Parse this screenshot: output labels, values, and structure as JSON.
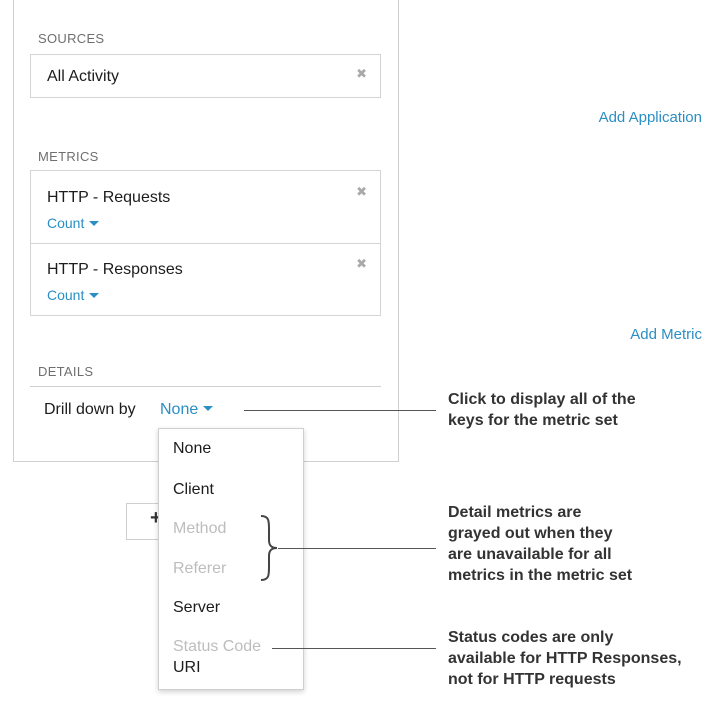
{
  "sources": {
    "label": "SOURCES",
    "items": [
      {
        "title": "All Activity",
        "close_icon": "close-icon"
      }
    ],
    "add_label": "Add Application"
  },
  "metrics": {
    "label": "METRICS",
    "items": [
      {
        "title": "HTTP - Requests",
        "aggregation": "Count"
      },
      {
        "title": "HTTP - Responses",
        "aggregation": "Count"
      }
    ],
    "add_label": "Add Metric"
  },
  "details": {
    "label": "DETAILS",
    "drill_label": "Drill down by",
    "drill_value": "None"
  },
  "dropdown": {
    "options": [
      {
        "label": "None",
        "enabled": true
      },
      {
        "label": "Client",
        "enabled": true
      },
      {
        "label": "Method",
        "enabled": false
      },
      {
        "label": "Referer",
        "enabled": false
      },
      {
        "label": "Server",
        "enabled": true
      },
      {
        "label": "Status Code",
        "enabled": false
      },
      {
        "label": "URI",
        "enabled": true
      }
    ]
  },
  "callouts": [
    {
      "lines": [
        "Click to display all of the",
        "keys for the metric set"
      ]
    },
    {
      "lines": [
        "Detail metrics are",
        "grayed out when they",
        "are unavailable for all",
        "metrics in the metric set"
      ]
    },
    {
      "lines": [
        "Status codes are only",
        "available for HTTP Responses,",
        "not for HTTP requests"
      ]
    }
  ],
  "colors": {
    "link": "#2a8fc4",
    "disabled": "#bdbdbd",
    "text": "#1c1c1c"
  }
}
